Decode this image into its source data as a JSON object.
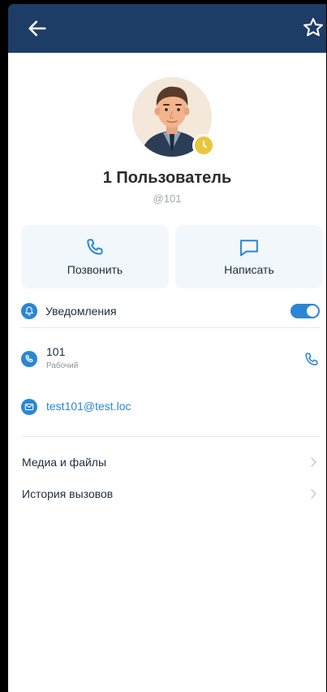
{
  "header": {
    "back_icon": "arrow-left-icon",
    "favorite_icon": "star-outline-icon",
    "background": "#1d3d66"
  },
  "profile": {
    "name": "1 Пользователь",
    "handle": "@101",
    "status_icon": "clock-icon",
    "status_color": "#e9c63a"
  },
  "actions": {
    "call_label": "Позвонить",
    "message_label": "Написать"
  },
  "notifications": {
    "label": "Уведомления",
    "enabled": true
  },
  "phone": {
    "number": "101",
    "type": "Рабочий"
  },
  "email": {
    "address": "test101@test.loc"
  },
  "links": {
    "media": "Медиа и файлы",
    "call_history": "История вызовов"
  },
  "colors": {
    "accent": "#2a86d5",
    "card_bg": "#f1f7fa"
  }
}
